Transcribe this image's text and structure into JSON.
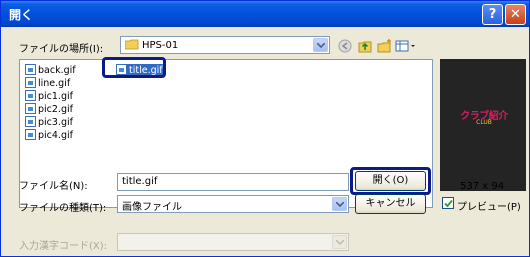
{
  "window": {
    "title": "開く",
    "help_label": "?",
    "close_label": "✕"
  },
  "location": {
    "label": "ファイルの場所(I):",
    "value": "HPS-01"
  },
  "toolbar": {
    "icons": [
      "back-icon",
      "up-folder-icon",
      "new-folder-icon",
      "view-menu-icon"
    ]
  },
  "files": [
    {
      "name": "back.gif"
    },
    {
      "name": "line.gif"
    },
    {
      "name": "pic1.gif"
    },
    {
      "name": "pic2.gif"
    },
    {
      "name": "pic3.gif"
    },
    {
      "name": "pic4.gif"
    },
    {
      "name": "title.gif",
      "selected": true
    }
  ],
  "filename": {
    "label": "ファイル名(N):",
    "value": "title.gif"
  },
  "filetype": {
    "label": "ファイルの種類(T):",
    "value": "画像ファイル"
  },
  "encoding": {
    "label": "入力漢字コード(X):",
    "value": ""
  },
  "buttons": {
    "open": "開く(O)",
    "cancel": "キャンセル"
  },
  "preview": {
    "image_text": "クラブ紹介",
    "image_subtext": "CLUB",
    "dimensions": "537 x 94",
    "checkbox_label": "プレビュー(P)",
    "checked": true
  },
  "colors": {
    "titlebar": "#0250da",
    "selection": "#316ac5",
    "highlight_border": "#0c1a8a"
  }
}
